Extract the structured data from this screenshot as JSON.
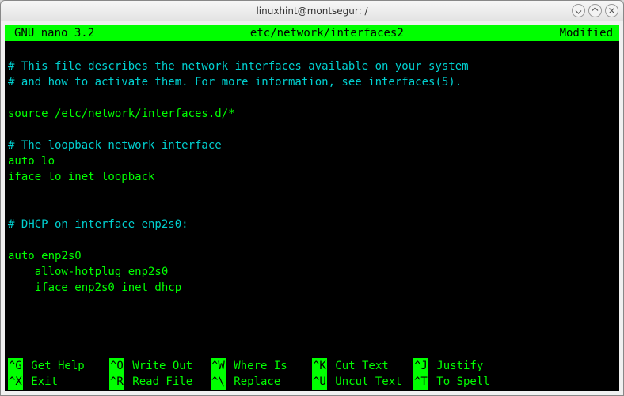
{
  "window": {
    "title": "linuxhint@montsegur: /"
  },
  "nano": {
    "version": "GNU nano 3.2",
    "filepath": "etc/network/interfaces2",
    "status": "Modified"
  },
  "content": {
    "lines": [
      {
        "text": "",
        "cls": "normal"
      },
      {
        "text": "# This file describes the network interfaces available on your system",
        "cls": "comment"
      },
      {
        "text": "# and how to activate them. For more information, see interfaces(5).",
        "cls": "comment"
      },
      {
        "text": "",
        "cls": "normal"
      },
      {
        "text": "source /etc/network/interfaces.d/*",
        "cls": "normal"
      },
      {
        "text": "",
        "cls": "normal"
      },
      {
        "text": "# The loopback network interface",
        "cls": "comment"
      },
      {
        "text": "auto lo",
        "cls": "normal"
      },
      {
        "text": "iface lo inet loopback",
        "cls": "normal"
      },
      {
        "text": "",
        "cls": "normal"
      },
      {
        "text": "",
        "cls": "normal"
      },
      {
        "text": "# DHCP on interface enp2s0:",
        "cls": "comment"
      },
      {
        "text": "",
        "cls": "normal"
      },
      {
        "text": "auto enp2s0",
        "cls": "normal"
      },
      {
        "text": "    allow-hotplug enp2s0",
        "cls": "normal"
      },
      {
        "text": "    iface enp2s0 inet dhcp",
        "cls": "normal"
      },
      {
        "text": "",
        "cls": "normal"
      },
      {
        "text": "",
        "cls": "normal"
      }
    ]
  },
  "shortcuts": {
    "row1": [
      {
        "key": "^G",
        "label": "Get Help"
      },
      {
        "key": "^O",
        "label": "Write Out"
      },
      {
        "key": "^W",
        "label": "Where Is"
      },
      {
        "key": "^K",
        "label": "Cut Text"
      },
      {
        "key": "^J",
        "label": "Justify"
      },
      {
        "key": "",
        "label": ""
      }
    ],
    "row2": [
      {
        "key": "^X",
        "label": "Exit"
      },
      {
        "key": "^R",
        "label": "Read File"
      },
      {
        "key": "^\\",
        "label": "Replace"
      },
      {
        "key": "^U",
        "label": "Uncut Text"
      },
      {
        "key": "^T",
        "label": "To Spell"
      },
      {
        "key": "",
        "label": ""
      }
    ]
  }
}
